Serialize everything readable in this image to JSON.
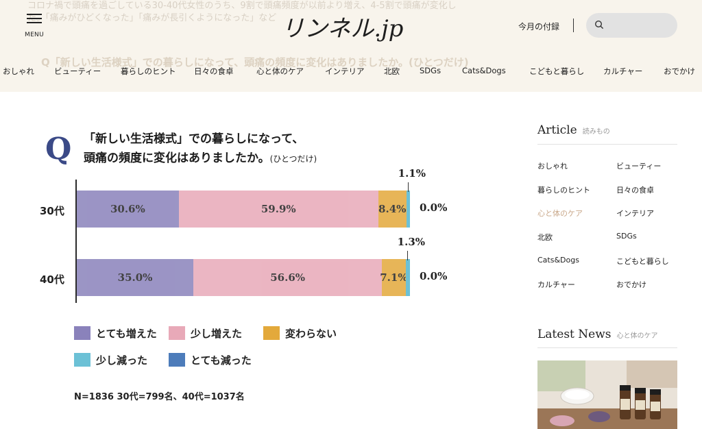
{
  "header": {
    "menu_label": "MENU",
    "logo_text": "リンネル.jp",
    "supplement_link": "今月の付録",
    "background_text_lines": [
      "コロナ禍で頭痛を過ごしている30-40代女性のうち、9割で頭痛頻度が以前より増え、4-5割で頭痛が変化し",
      "た。「痛みがひどくなった」「痛みが長引くようになった」など"
    ],
    "background_question": "Q「新しい生活様式」での暮らしになって、頭痛の頻度に変化はありましたか。(ひとつだけ)",
    "nav": [
      "おしゃれ",
      "ビューティー",
      "暮らしのヒント",
      "日々の食卓",
      "心と体のケア",
      "インテリア",
      "北欧",
      "SDGs",
      "Cats&Dogs",
      "こどもと暮らし",
      "カルチャー",
      "おでかけ"
    ]
  },
  "chart": {
    "q_mark": "Q",
    "question_line1": "「新しい生活様式」での暮らしになって、",
    "question_line2": "頭痛の頻度に変化はありましたか。",
    "question_suffix": "(ひとつだけ)",
    "footnote": "N=1836 30代=799名、40代=1037名",
    "colors": {
      "greatly_increased": "#8a82bb",
      "slightly_increased": "#e8a9b8",
      "unchanged": "#e3a93b",
      "slightly_decreased": "#6cc1d6",
      "greatly_decreased": "#4d7cba"
    },
    "legend": [
      "とても増えた",
      "少し増えた",
      "変わらない",
      "少し減った",
      "とても減った"
    ]
  },
  "chart_data": {
    "type": "bar",
    "orientation": "horizontal-stacked",
    "title": "「新しい生活様式」での暮らしになって、頭痛の頻度に変化はありましたか。(ひとつだけ)",
    "categories": [
      "30代",
      "40代"
    ],
    "series": [
      {
        "name": "とても増えた",
        "values": [
          30.6,
          35.0
        ],
        "labels": [
          "30.6%",
          "35.0%"
        ]
      },
      {
        "name": "少し増えた",
        "values": [
          59.9,
          56.6
        ],
        "labels": [
          "59.9%",
          "56.6%"
        ]
      },
      {
        "name": "変わらない",
        "values": [
          8.4,
          7.1
        ],
        "labels": [
          "8.4%",
          "7.1%"
        ]
      },
      {
        "name": "少し減った",
        "values": [
          1.1,
          1.3
        ],
        "labels": [
          "1.1%",
          "1.3%"
        ]
      },
      {
        "name": "とても減った",
        "values": [
          0.0,
          0.0
        ],
        "labels": [
          "0.0%",
          "0.0%"
        ]
      }
    ],
    "xlim": [
      0,
      100
    ],
    "legend_position": "bottom",
    "grid": false
  },
  "sidebar": {
    "article_title": "Article",
    "article_sub": "読みもの",
    "links": [
      "おしゃれ",
      "ビューティー",
      "暮らしのヒント",
      "日々の食卓",
      "心と体のケア",
      "インテリア",
      "北欧",
      "SDGs",
      "Cats&Dogs",
      "こどもと暮らし",
      "カルチャー",
      "おでかけ"
    ],
    "active_link": "心と体のケア",
    "news_title": "Latest News",
    "news_sub": "心と体のケア"
  }
}
